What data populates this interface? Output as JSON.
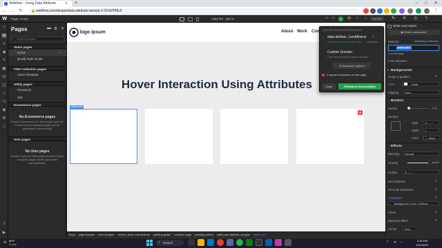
{
  "browser": {
    "tab_title": "Webflow - Using Data Attribute",
    "url": "webflow.com/design/data-attribute-tutorial-3-210d7f49c5"
  },
  "topbar": {
    "page_label": "Page: Home",
    "viewport_size": "1452 PX",
    "zoom": "100 %",
    "publish_label": "Publish"
  },
  "pages_panel": {
    "title": "Pages",
    "search_placeholder": "Search pages",
    "static_pages_label": "Static pages",
    "static_pages": [
      "Home",
      "[Draft] Style Guide"
    ],
    "cms_label": "CMS Collection pages",
    "cms_pages": [
      "Cities Template"
    ],
    "utility_label": "Utility pages",
    "utility_pages": [
      "Password",
      "404"
    ],
    "ecommerce_label": "Ecommerce pages",
    "ecommerce_empty_title": "No Ecommerce pages",
    "ecommerce_empty_desc": "Enable Ecommerce for this project and the Ecommerce templates pages will be generated automatically.",
    "user_label": "User pages",
    "user_empty_title": "No User pages",
    "user_empty_desc": "Enable Users for this project and the Users template pages will be generated automatically."
  },
  "site": {
    "logo_text": "logo ipsum",
    "nav": [
      "About",
      "Work",
      "Con"
    ],
    "hero_title": "Hover Interaction Using Attributes",
    "card_label": "white-card"
  },
  "publish_popover": {
    "header": "CHOOSE PUBLISH DESTINATION",
    "domain": "data-attribut...l.webflow.io",
    "domain_status": "Published a few seconds ago",
    "domain_extra": "Unpublish",
    "custom_title": "Custom Domain",
    "custom_desc": "Click here to add a custom domain",
    "advanced": "Advanced options",
    "issues": "2 issues to improve on this page",
    "close": "Close",
    "success": "Published Successfully!"
  },
  "style_panel": {
    "element": "white-card Styles",
    "create_component": "Create component",
    "selector_label": "Selector",
    "inheriting": "Inheriting 2 selectors",
    "selector_chip": "white-card",
    "on_page": "1 on this page",
    "font_variations": "Font variations",
    "backgrounds": "Backgrounds",
    "image_gradient": "Image & gradient",
    "color_label": "Color",
    "color_value": "white",
    "clipping_label": "Clipping",
    "clipping_value": "None",
    "borders": "Borders",
    "radius_label": "Radius",
    "radius_value": "0",
    "radius_unit": "PX",
    "borders_label": "Borders",
    "style_label": "Style",
    "width_label": "Width",
    "width_value": "1",
    "color2_label": "Color",
    "color2_value": "black",
    "effects": "Effects",
    "blending_label": "Blending",
    "blending_value": "Normal",
    "opacity_label": "Opacity",
    "opacity_value": "100",
    "opacity_unit": "%",
    "outline_label": "Outline",
    "box_shadows": "Box shadows",
    "transforms": "2D & 3D transforms",
    "transitions": "Transitions",
    "transition_item": "Background Color: 1000ms",
    "filters": "Filters",
    "backdrop": "Backdrop filters",
    "cursor_label": "Cursor",
    "cursor_value": "auto"
  },
  "breadcrumbs": [
    "Body",
    "page-wrapper",
    "main-wrapper",
    "section_static-card-attribute",
    "padding-global",
    "container-large",
    "padding-vertical",
    "static-card-attribute_wrapper",
    "white-card"
  ],
  "taskbar": {
    "temp": "85°F",
    "weather": "Sunny",
    "search": "Search",
    "time": "2:25 PM",
    "date": "1/21/2023"
  },
  "colors": {
    "accent": "#4b8ff7",
    "publish_green": "#21a34a",
    "hero": "#1d2a44"
  }
}
